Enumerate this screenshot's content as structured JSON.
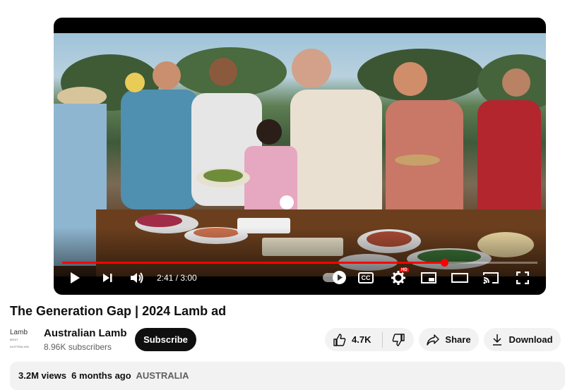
{
  "player": {
    "progress_fraction": 0.8033,
    "time_current": "2:41",
    "time_separator": " / ",
    "time_total": "3:00",
    "hd_badge": "HD",
    "cc_label": "CC",
    "accent_color": "#ff0000"
  },
  "video": {
    "title": "The Generation Gap | 2024 Lamb ad"
  },
  "channel": {
    "logo_text": "Lamb",
    "logo_subtext": "MEAT AUSTRALIAN",
    "name": "Australian Lamb",
    "subscribers": "8.96K subscribers",
    "subscribe_label": "Subscribe"
  },
  "actions": {
    "like_count": "4.7K",
    "share_label": "Share",
    "download_label": "Download"
  },
  "description": {
    "views": "3.2M views",
    "age": "6 months ago",
    "tag": "AUSTRALIA"
  },
  "icons": [
    "play-icon",
    "next-icon",
    "volume-icon",
    "autoplay-toggle-icon",
    "captions-icon",
    "settings-icon",
    "miniplayer-icon",
    "theater-mode-icon",
    "cast-icon",
    "fullscreen-icon",
    "thumbs-up-icon",
    "thumbs-down-icon",
    "share-icon",
    "download-icon"
  ]
}
